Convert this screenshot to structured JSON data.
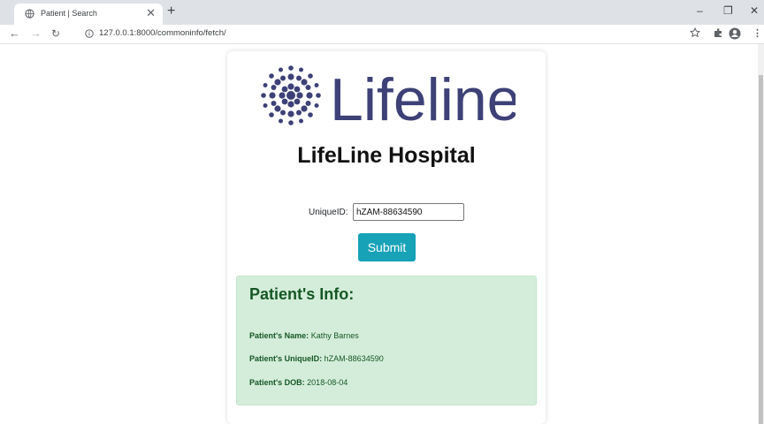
{
  "browser": {
    "tab_title": "Patient | Search",
    "url": "127.0.0.1:8000/commoninfo/fetch/"
  },
  "page": {
    "logo_text": "Lifeline",
    "hospital_name": "LifeLine Hospital",
    "form": {
      "uid_label": "UniqueID:",
      "uid_value": "hZAM-88634590",
      "submit_label": "Submit"
    },
    "info": {
      "title": "Patient's Info:",
      "name_label": "Patient's Name:",
      "name_value": "Kathy Barnes",
      "uid_label": "Patient's UniqueID:",
      "uid_value": "hZAM-88634590",
      "dob_label": "Patient's DOB:",
      "dob_value": "2018-08-04"
    }
  },
  "colors": {
    "brand": "#3d4177",
    "submit_button": "#17a2b8",
    "info_background": "#d4edda",
    "info_text": "#155724"
  }
}
